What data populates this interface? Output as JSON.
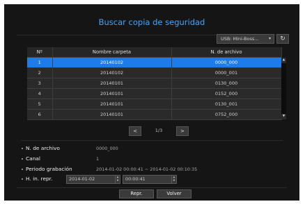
{
  "dialog": {
    "title": "Buscar copia de seguridad"
  },
  "toolbar": {
    "device_select": "USB: Mini-Boss...",
    "device_chevron": "▾",
    "refresh_icon": "refresh-icon"
  },
  "table": {
    "headers": {
      "index": "Nº",
      "folder": "Nombre carpeta",
      "file": "N. de archivo"
    },
    "rows": [
      {
        "index": "1",
        "folder": "20140102",
        "file": "0000_000"
      },
      {
        "index": "2",
        "folder": "20140102",
        "file": "0000_001"
      },
      {
        "index": "3",
        "folder": "20140101",
        "file": "0130_000"
      },
      {
        "index": "4",
        "folder": "20140101",
        "file": "0152_000"
      },
      {
        "index": "5",
        "folder": "20140101",
        "file": "0130_001"
      },
      {
        "index": "6",
        "folder": "20140101",
        "file": "0752_000"
      }
    ],
    "selected_row": 1
  },
  "pager": {
    "prev": "<",
    "page": "1/3",
    "next": ">"
  },
  "info": {
    "file_label": "N. de archivo",
    "file_value": "0000_000",
    "channel_label": "Canal",
    "channel_value": "1",
    "period_label": "Periodo grabación",
    "period_value": "2014-01-02 00:00:41 ~ 2014-01-02 00:10:35",
    "start_label": "H. in. repr.",
    "start_date": "2014-01-02",
    "start_time": "00:00:41"
  },
  "actions": {
    "play": "Repr.",
    "back": "Volver"
  },
  "colors": {
    "accent": "#3fa6ff",
    "selection": "#1e7bea",
    "panel": "#151515"
  }
}
